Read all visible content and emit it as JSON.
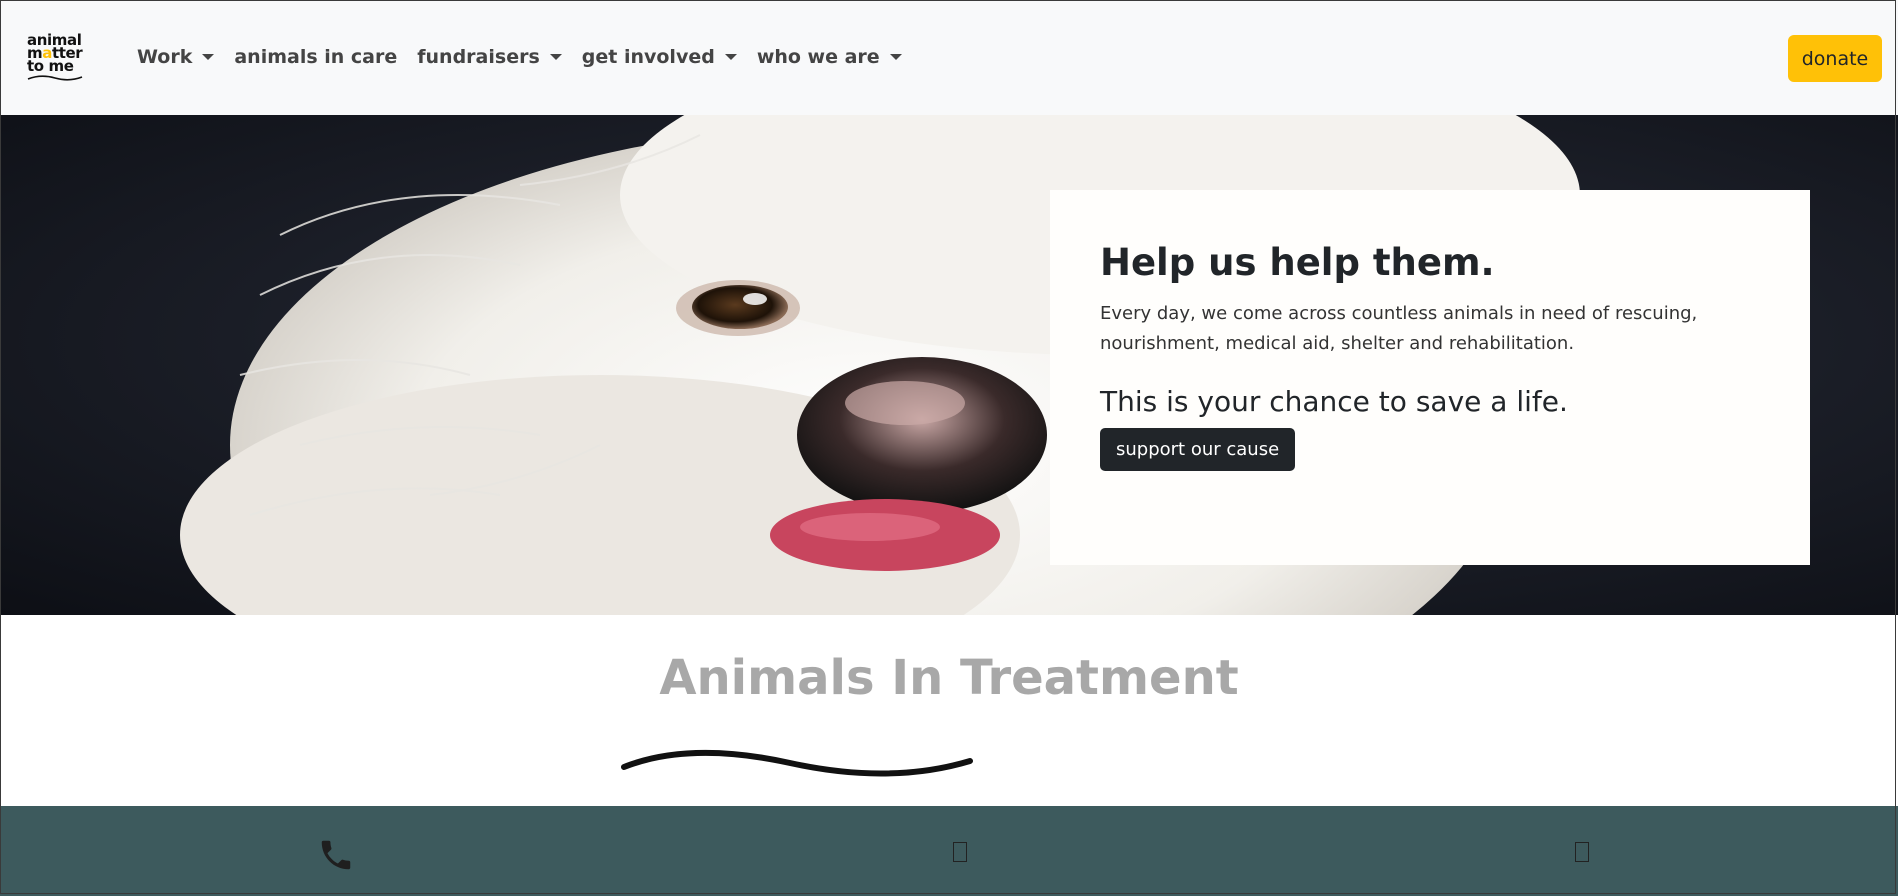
{
  "logo": {
    "line1": "animal",
    "line2_a": "m",
    "line2_dot": "a",
    "line2_b": "tter",
    "line3": "to me"
  },
  "nav": {
    "items": [
      {
        "label": "Work",
        "dropdown": true
      },
      {
        "label": "animals in care",
        "dropdown": false
      },
      {
        "label": "fundraisers",
        "dropdown": true
      },
      {
        "label": "get involved",
        "dropdown": true
      },
      {
        "label": "who we are",
        "dropdown": true
      }
    ],
    "donate_label": "donate"
  },
  "hero": {
    "heading": "Help us help them.",
    "body": "Every day, we come across countless animals in need of rescuing, nourishment, medical aid, shelter and rehabilitation.",
    "subheading": "This is your chance to save a life.",
    "cta_label": "support our cause"
  },
  "section": {
    "title": "Animals In Treatment"
  },
  "footer": {
    "icons": [
      "phone-icon",
      "missing-glyph-icon",
      "missing-glyph-icon"
    ]
  },
  "colors": {
    "navbar_bg": "#f8f9fa",
    "donate_bg": "#ffc107",
    "cta_bg": "#212529",
    "footer_bg": "#3d5a5d",
    "section_title": "#a8a8a8"
  }
}
